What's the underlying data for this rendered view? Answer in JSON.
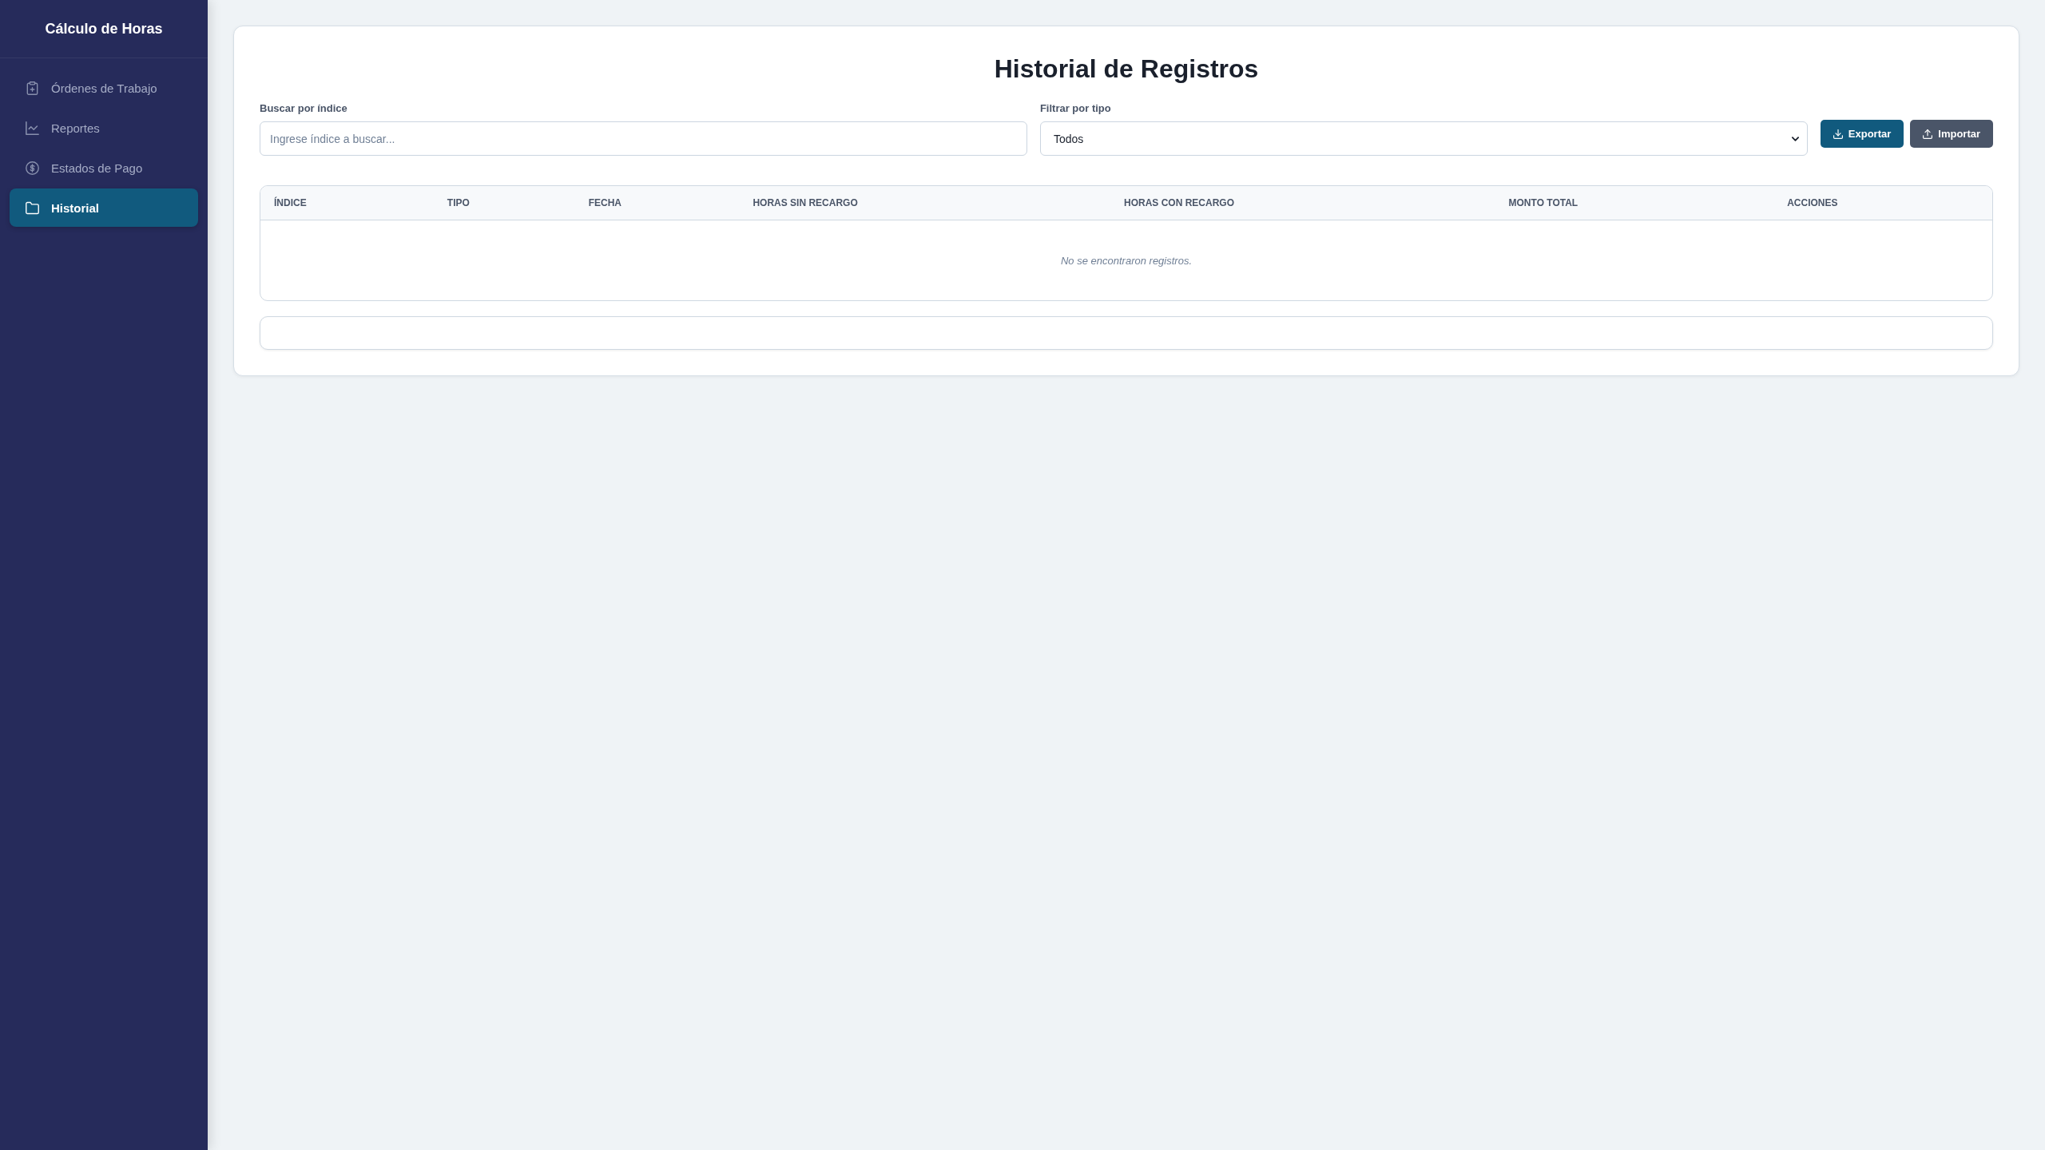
{
  "sidebar": {
    "title": "Cálculo de Horas",
    "items": [
      {
        "label": "Órdenes de Trabajo",
        "selected": false
      },
      {
        "label": "Reportes",
        "selected": false
      },
      {
        "label": "Estados de Pago",
        "selected": false
      },
      {
        "label": "Historial",
        "selected": true
      }
    ]
  },
  "page": {
    "title": "Historial de Registros",
    "search": {
      "label": "Buscar por índice",
      "placeholder": "Ingrese índice a buscar..."
    },
    "filter": {
      "label": "Filtrar por tipo",
      "value": "Todos"
    },
    "buttons": [
      {
        "label": "Exportar",
        "kind": "export"
      },
      {
        "label": "Importar",
        "kind": "import"
      }
    ],
    "table": {
      "columns": [
        "ÍNDICE",
        "TIPO",
        "FECHA",
        "HORAS SIN RECARGO",
        "HORAS CON RECARGO",
        "MONTO TOTAL",
        "ACCIONES"
      ],
      "empty_message": "No se encontraron registros."
    }
  }
}
